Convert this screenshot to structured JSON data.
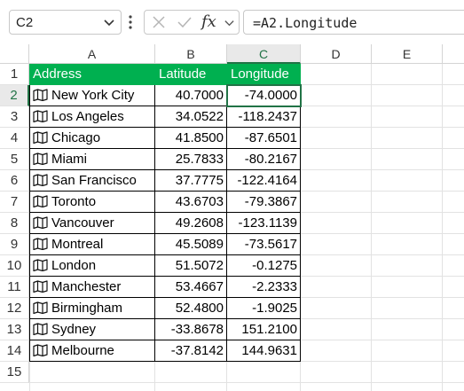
{
  "formula_bar": {
    "name_box": "C2",
    "fx_label": "fx",
    "formula": "=A2.Longitude"
  },
  "columns": [
    "A",
    "B",
    "C",
    "D",
    "E"
  ],
  "rows": [
    "1",
    "2",
    "3",
    "4",
    "5",
    "6",
    "7",
    "8",
    "9",
    "10",
    "11",
    "12",
    "13",
    "14",
    "15"
  ],
  "table": {
    "header_color": "#00b050",
    "headers": [
      "Address",
      "Latitude",
      "Longitude"
    ],
    "data": [
      {
        "address": "New York City",
        "lat": "40.7000",
        "lon": "-74.0000"
      },
      {
        "address": "Los Angeles",
        "lat": "34.0522",
        "lon": "-118.2437"
      },
      {
        "address": "Chicago",
        "lat": "41.8500",
        "lon": "-87.6501"
      },
      {
        "address": "Miami",
        "lat": "25.7833",
        "lon": "-80.2167"
      },
      {
        "address": "San Francisco",
        "lat": "37.7775",
        "lon": "-122.4164"
      },
      {
        "address": "Toronto",
        "lat": "43.6703",
        "lon": "-79.3867"
      },
      {
        "address": "Vancouver",
        "lat": "49.2608",
        "lon": "-123.1139"
      },
      {
        "address": "Montreal",
        "lat": "45.5089",
        "lon": "-73.5617"
      },
      {
        "address": "London",
        "lat": "51.5072",
        "lon": "-0.1275"
      },
      {
        "address": "Manchester",
        "lat": "53.4667",
        "lon": "-2.2333"
      },
      {
        "address": "Birmingham",
        "lat": "52.4800",
        "lon": "-1.9025"
      },
      {
        "address": "Sydney",
        "lat": "-33.8678",
        "lon": "151.2100"
      },
      {
        "address": "Melbourne",
        "lat": "-37.8142",
        "lon": "144.9631"
      }
    ]
  },
  "icons": {
    "address_cell_icon": "map-icon",
    "name_box_dropdown": "chevron-down-icon",
    "cancel": "close-icon",
    "enter": "check-icon"
  },
  "accent_color": "#217346"
}
